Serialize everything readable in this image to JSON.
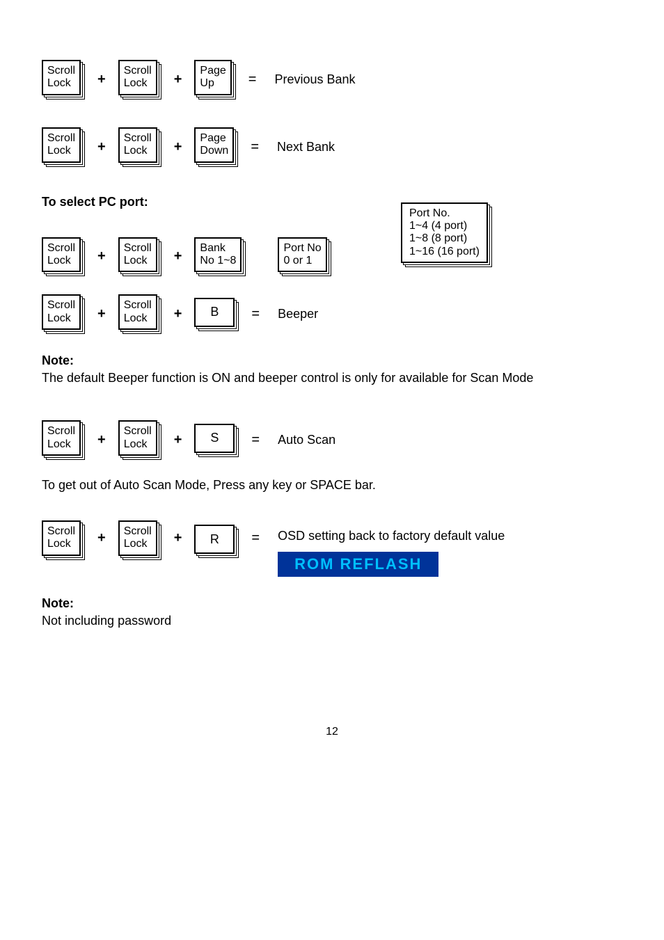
{
  "rows": {
    "prev_bank": {
      "k1": "Scroll\nLock",
      "k2": "Scroll\nLock",
      "k3": "Page\nUp",
      "result": "Previous Bank"
    },
    "next_bank": {
      "k1": "Scroll\nLock",
      "k2": "Scroll\nLock",
      "k3": "Page\nDown",
      "result": "Next Bank"
    },
    "select_title": "To select PC port:",
    "select_port": {
      "k1": "Scroll\nLock",
      "k2": "Scroll\nLock",
      "k3": "Bank\nNo 1~8",
      "k4": "Port No\n0 or 1",
      "info": "Port No.\n1~4 (4 port)\n1~8 (8 port)\n1~16 (16 port)"
    },
    "beeper": {
      "k1": "Scroll\nLock",
      "k2": "Scroll\nLock",
      "k3": "B",
      "result": "Beeper"
    },
    "note1_title": "Note:",
    "note1_text": "The default Beeper function is ON and beeper control is only for available for Scan Mode",
    "auto_scan": {
      "k1": "Scroll\nLock",
      "k2": "Scroll\nLock",
      "k3": "S",
      "result": "Auto Scan"
    },
    "auto_scan_note": "To get out of Auto Scan Mode, Press any key or SPACE bar.",
    "osd_reset": {
      "k1": "Scroll\nLock",
      "k2": "Scroll\nLock",
      "k3": "R",
      "result": "OSD setting back to factory default value",
      "banner": "ROM   REFLASH"
    },
    "note2_title": "Note:",
    "note2_text": "Not including password",
    "page_num": "12"
  },
  "symbols": {
    "plus": "+",
    "equals": "="
  }
}
